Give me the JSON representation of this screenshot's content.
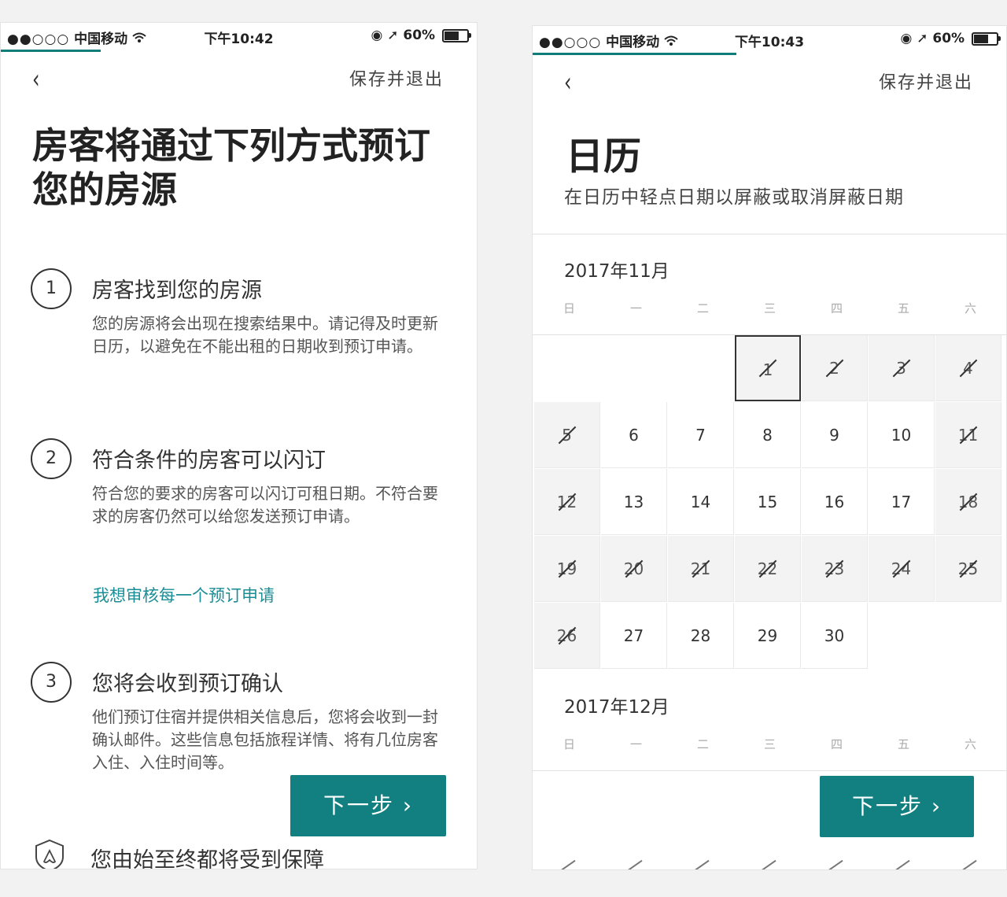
{
  "statusbar_left": {
    "carrier": "中国移动",
    "signal": "●●○○○",
    "time": "下午10:42",
    "battery": "60%"
  },
  "statusbar_right": {
    "carrier": "中国移动",
    "signal": "●●○○○",
    "time": "下午10:43",
    "battery": "60%"
  },
  "left": {
    "back_icon": "‹",
    "save_exit": "保存并退出",
    "progress": 0.21,
    "title": "房客将通过下列方式预订您的房源",
    "steps": [
      {
        "num": "1",
        "head": "房客找到您的房源",
        "body": "您的房源将会出现在搜索结果中。请记得及时更新日历，以避免在不能出租的日期收到预订申请。"
      },
      {
        "num": "2",
        "head": "符合条件的房客可以闪订",
        "body": "符合您的要求的房客可以闪订可租日期。不符合要求的房客仍然可以给您发送预订申请。"
      },
      {
        "num": "3",
        "head": "您将会收到预订确认",
        "body": "他们预订住宿并提供相关信息后，您将会收到一封确认邮件。这些信息包括旅程详情、将有几位房客入住、入住时间等。"
      }
    ],
    "review_link": "我想审核每一个预订申请",
    "next_button": "下一步 ›",
    "protect_text": "您由始至终都将受到保障"
  },
  "right": {
    "back_icon": "‹",
    "save_exit": "保存并退出",
    "progress": 0.43,
    "title": "日历",
    "subtitle": "在日历中轻点日期以屏蔽或取消屏蔽日期",
    "weekdays": [
      "日",
      "一",
      "二",
      "三",
      "四",
      "五",
      "六"
    ],
    "months": [
      {
        "label": "2017年11月",
        "first_weekday": 3,
        "days": 30,
        "blocked": [
          1,
          2,
          3,
          4,
          5,
          11,
          12,
          18,
          19,
          20,
          21,
          22,
          23,
          24,
          25,
          26
        ],
        "selected": [
          1
        ]
      },
      {
        "label": "2017年12月"
      }
    ],
    "next_button": "下一步 ›"
  }
}
